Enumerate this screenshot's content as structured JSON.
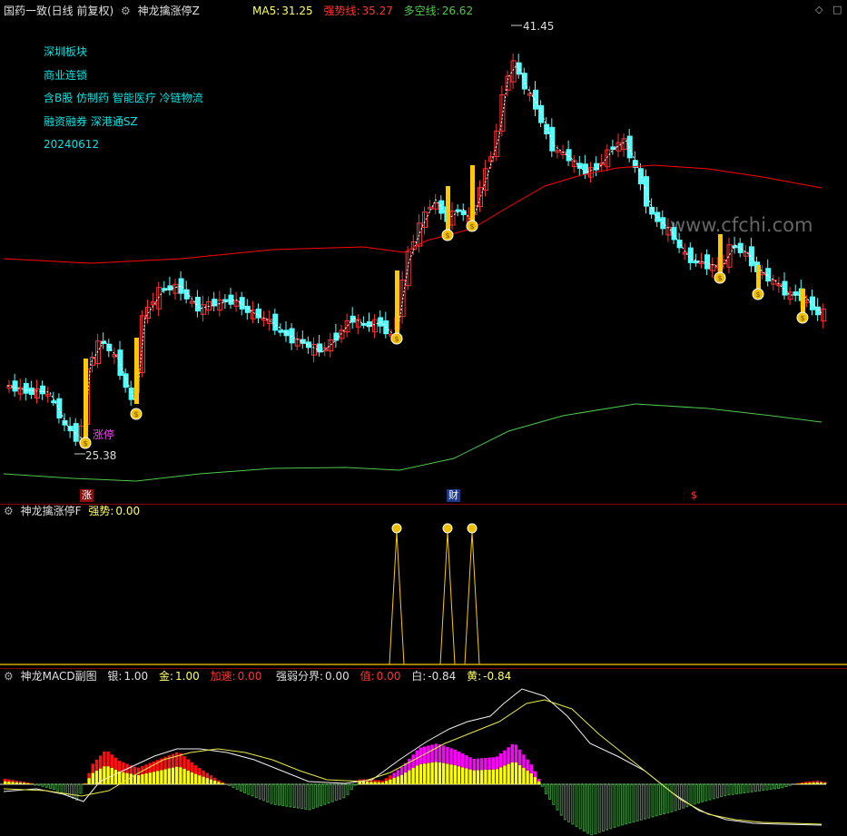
{
  "main": {
    "title": "国药一致(日线 前复权)",
    "indicator": "神龙擒涨停Z",
    "ma5_label": "MA5:",
    "ma5_value": "31.25",
    "strong_label": "强势线:",
    "strong_value": "35.27",
    "ls_label": "多空线:",
    "ls_value": "26.62",
    "info_lines": [
      "深圳板块",
      "商业连锁",
      "含B股 仿制药 智能医疗 冷链物流",
      "融资融券 深港通SZ",
      "20240612"
    ],
    "high_label": "41.45",
    "low_label": "25.38",
    "limit_up_label": "涨停",
    "watermark": "www.cfchi.com",
    "events": [
      "涨",
      "财",
      "$"
    ]
  },
  "sub1": {
    "title": "神龙擒涨停F",
    "strong_label": "强势:",
    "strong_value": "0.00"
  },
  "sub2": {
    "title": "神龙MACD副图",
    "silver_label": "银:",
    "silver_value": "1.00",
    "gold_label": "金:",
    "gold_value": "1.00",
    "accel_label": "加速:",
    "accel_value": "0.00",
    "boundary_label": "强弱分界:",
    "boundary_value": "0.00",
    "val_label": "值:",
    "val_value": "0.00",
    "white_label": "白:",
    "white_value": "-0.84",
    "yellow_label": "黄:",
    "yellow_value": "-0.84"
  },
  "colors": {
    "up": "#ff3232",
    "down": "#54ffff",
    "ma5": "#ffff64",
    "strong": "#ff0000",
    "longshort": "#4ec84e",
    "limit": "#ffc800",
    "magenta": "#ff00ff",
    "cyan": "#00e5e5"
  },
  "icons": [
    "gear-icon",
    "money-bag-icon",
    "diamond-icon",
    "square-icon"
  ]
}
